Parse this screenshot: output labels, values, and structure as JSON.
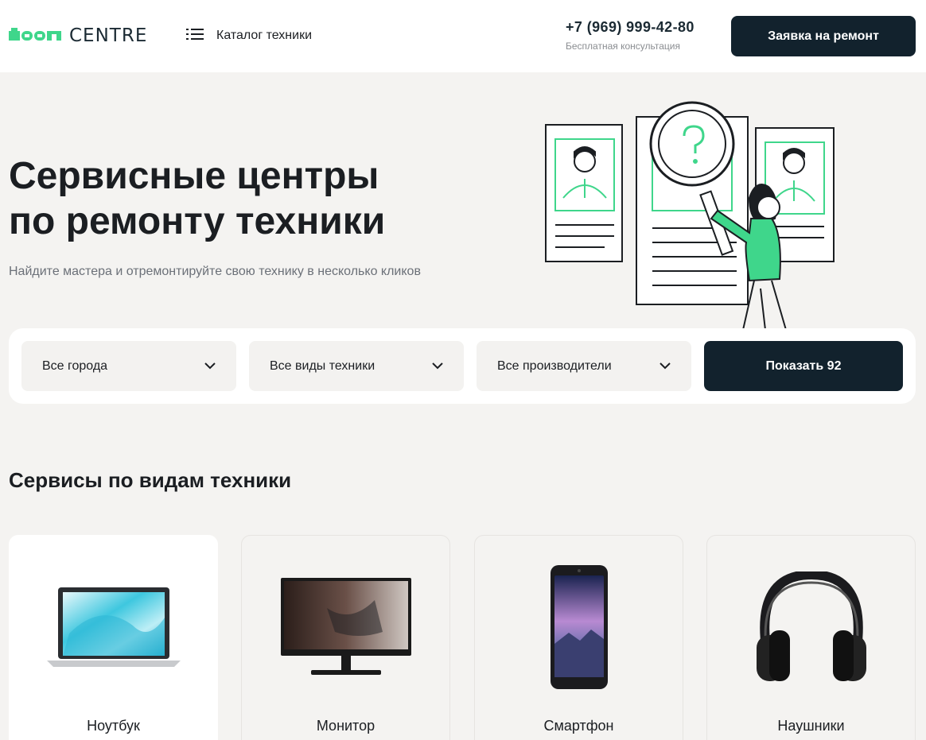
{
  "header": {
    "logo_text": "CENTRE",
    "logo_mark": "1001",
    "catalog_label": "Каталог техники",
    "catalog_icon": "list-icon",
    "phone": "+7 (969) 999-42-80",
    "phone_sub": "Бесплатная консультация",
    "repair_button": "Заявка на ремонт"
  },
  "hero": {
    "title_line1": "Сервисные центры",
    "title_line2": "по ремонту техники",
    "subtitle": "Найдите мастера и отремонтируйте свою технику в несколько кликов",
    "illustration": "search-specialist-illustration"
  },
  "filters": {
    "city": "Все города",
    "device_type": "Все виды техники",
    "manufacturer": "Все производители",
    "show_button": "Показать 92"
  },
  "section": {
    "title": "Сервисы по видам техники",
    "cards": [
      {
        "label": "Ноутбук",
        "icon": "laptop-image"
      },
      {
        "label": "Монитор",
        "icon": "monitor-image"
      },
      {
        "label": "Смартфон",
        "icon": "smartphone-image"
      },
      {
        "label": "Наушники",
        "icon": "headphones-image"
      }
    ]
  },
  "colors": {
    "accent_green": "#3fd68b",
    "dark_navy": "#12222d",
    "page_bg": "#f4f3f1"
  }
}
